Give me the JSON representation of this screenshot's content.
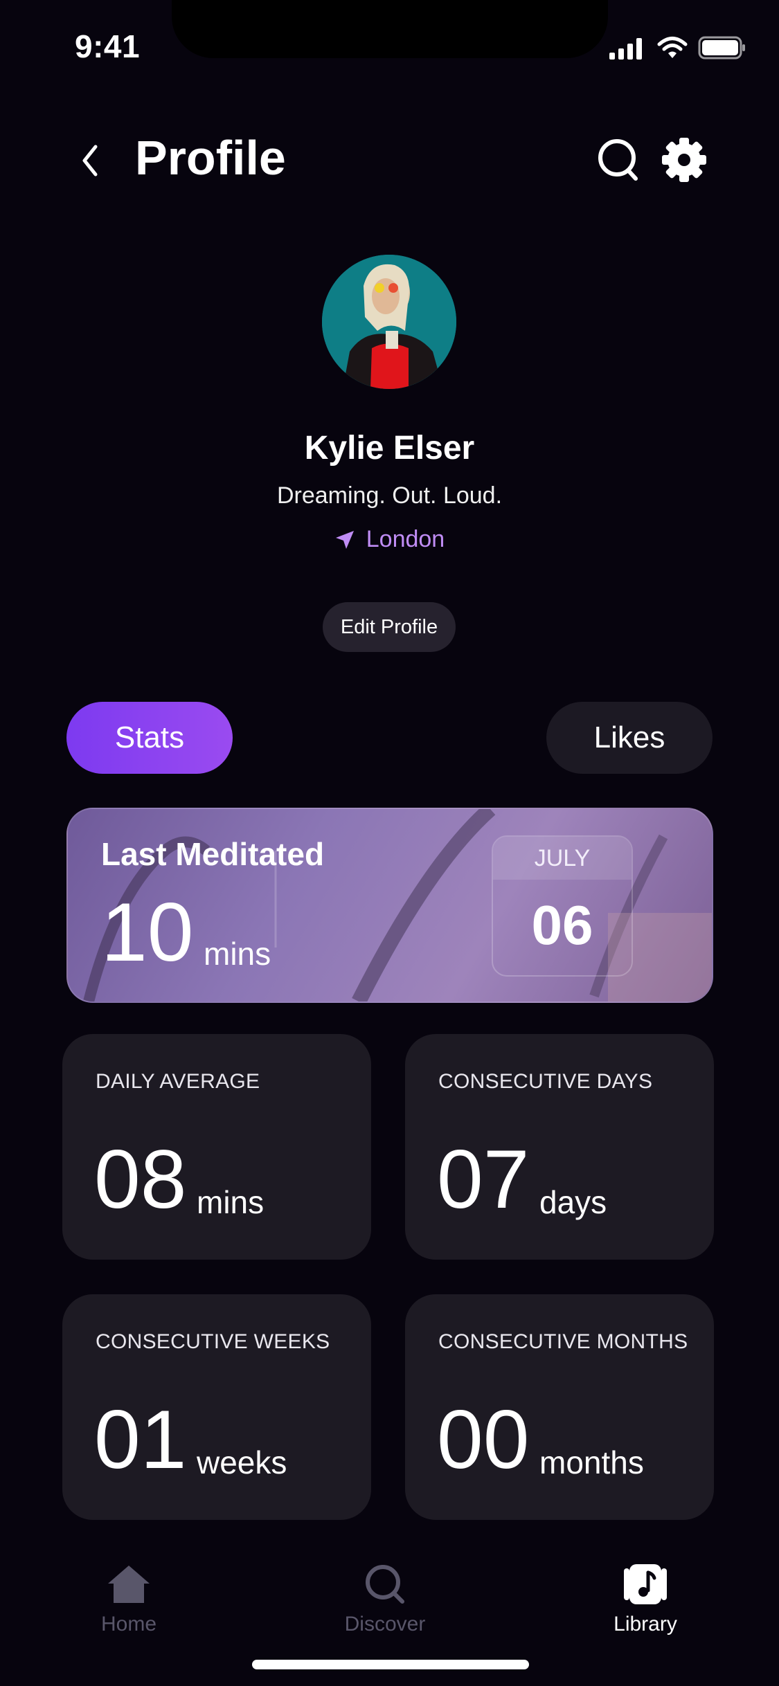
{
  "status_bar": {
    "time": "9:41"
  },
  "header": {
    "title": "Profile"
  },
  "profile": {
    "name": "Kylie Elser",
    "bio": "Dreaming. Out. Loud.",
    "location": "London",
    "edit_label": "Edit Profile"
  },
  "tabs": [
    {
      "label": "Stats",
      "active": true
    },
    {
      "label": "Likes",
      "active": false
    }
  ],
  "last_meditated": {
    "label": "Last Meditated",
    "value": "10",
    "unit": "mins",
    "month": "JULY",
    "day": "06"
  },
  "stats": [
    {
      "label": "DAILY AVERAGE",
      "value": "08",
      "unit": "mins"
    },
    {
      "label": "CONSECUTIVE DAYS",
      "value": "07",
      "unit": "days"
    },
    {
      "label": "CONSECUTIVE WEEKS",
      "value": "01",
      "unit": "weeks"
    },
    {
      "label": "CONSECUTIVE MONTHS",
      "value": "00",
      "unit": "months"
    }
  ],
  "nav": [
    {
      "label": "Home",
      "icon": "home-icon",
      "active": false
    },
    {
      "label": "Discover",
      "icon": "search-icon",
      "active": false
    },
    {
      "label": "Library",
      "icon": "music-library-icon",
      "active": true
    }
  ],
  "colors": {
    "background": "#07040e",
    "accent": "#8b44f1",
    "location": "#c08df5",
    "card": "#1d1a23",
    "inactive_nav": "#59566a"
  }
}
